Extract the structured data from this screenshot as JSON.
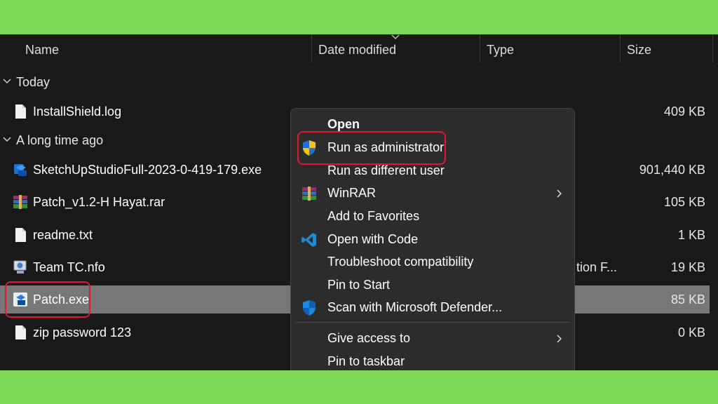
{
  "columns": {
    "name": "Name",
    "date_modified": "Date modified",
    "type": "Type",
    "size": "Size"
  },
  "groups": {
    "today": "Today",
    "long_ago": "A long time ago"
  },
  "files": [
    {
      "name": "InstallShield.log",
      "size": "409 KB",
      "icon": "document-icon"
    },
    {
      "name": "SketchUpStudioFull-2023-0-419-179.exe",
      "size": "901,440 KB",
      "icon": "sketchup-installer-icon"
    },
    {
      "name": "Patch_v1.2-H Hayat.rar",
      "size": "105 KB",
      "icon": "winrar-archive-icon"
    },
    {
      "name": "readme.txt",
      "size": "1 KB",
      "icon": "text-file-icon"
    },
    {
      "name": "Team TC.nfo",
      "size": "19 KB",
      "type_partial": "tion F...",
      "icon": "nfo-file-icon"
    },
    {
      "name": "Patch.exe",
      "size": "85 KB",
      "icon": "patch-exe-icon",
      "selected": true
    },
    {
      "name": "zip password 123",
      "size": "0 KB",
      "icon": "blank-file-icon"
    }
  ],
  "context_menu": {
    "items": [
      {
        "label": "Open",
        "bold": true
      },
      {
        "label": "Run as administrator",
        "icon": "uac-shield-icon",
        "highlighted": true
      },
      {
        "label": "Run as different user"
      },
      {
        "label": "WinRAR",
        "icon": "winrar-icon",
        "submenu": true
      },
      {
        "label": "Add to Favorites"
      },
      {
        "label": "Open with Code",
        "icon": "vscode-icon"
      },
      {
        "label": "Troubleshoot compatibility"
      },
      {
        "label": "Pin to Start"
      },
      {
        "label": "Scan with Microsoft Defender...",
        "icon": "defender-shield-icon"
      },
      {
        "label": "Give access to",
        "submenu": true
      },
      {
        "label": "Pin to taskbar"
      }
    ]
  },
  "colors": {
    "background_frame": "#7ed957",
    "explorer_bg": "#191919",
    "menu_bg": "#2c2c2c",
    "selection": "#777777",
    "highlight_box": "#e0182b"
  }
}
